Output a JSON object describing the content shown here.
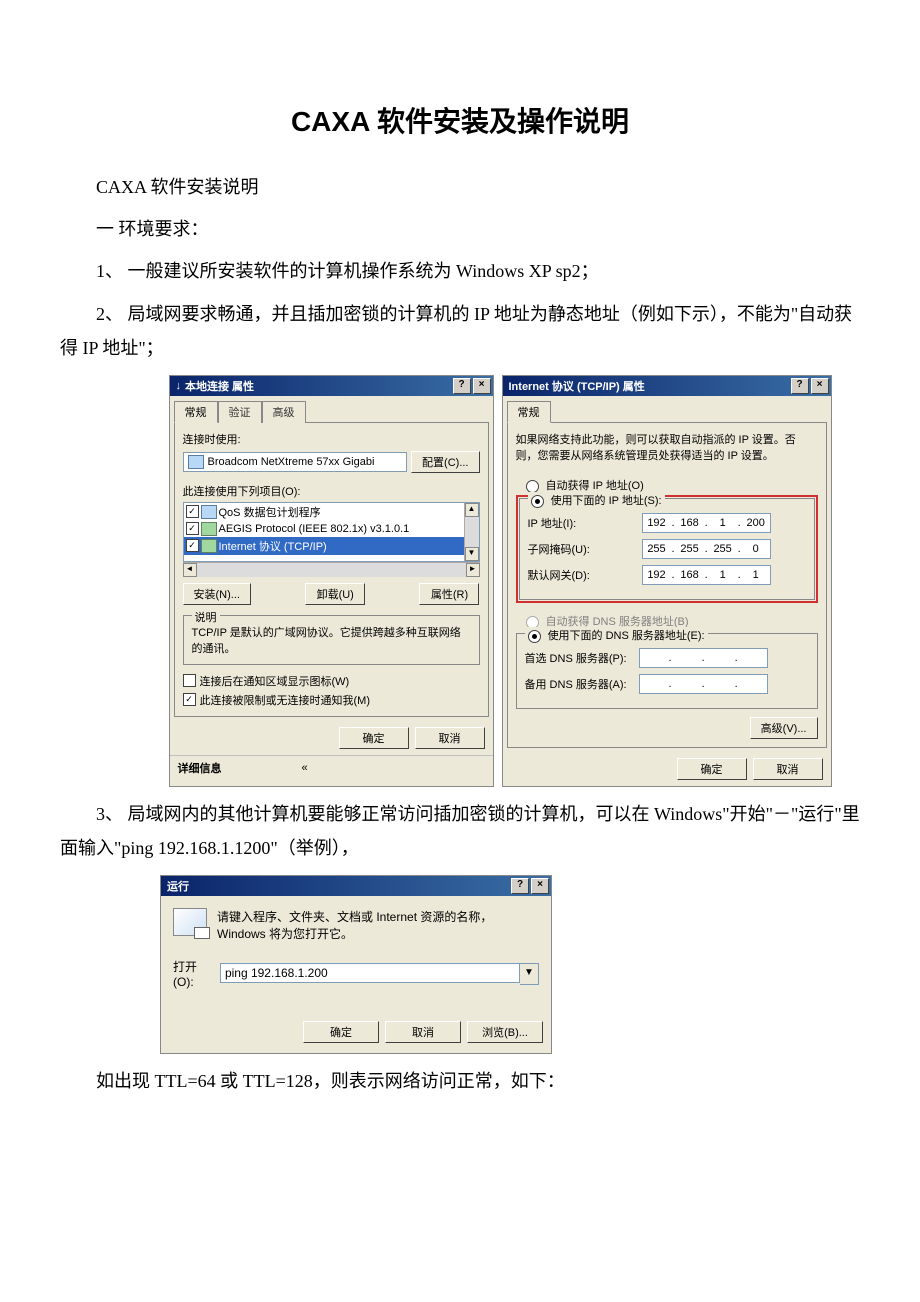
{
  "title": "CAXA 软件安装及操作说明",
  "p_sub": "CAXA 软件安装说明",
  "p_env": "一 环境要求：",
  "p1": "1、 一般建议所安装软件的计算机操作系统为 Windows XP sp2；",
  "p2": "2、 局域网要求畅通，并且插加密锁的计算机的 IP 地址为静态地址（例如下示），不能为\"自动获得 IP 地址\"；",
  "p3": "3、 局域网内的其他计算机要能够正常访问插加密锁的计算机，可以在 Windows\"开始\"－\"运行\"里面输入\"ping 192.168.1.1200\"（举例），",
  "p4": "如出现 TTL=64 或 TTL=128，则表示网络访问正常，如下：",
  "lan": {
    "title": "本地连接 属性",
    "tabs": {
      "general": "常规",
      "auth": "验证",
      "adv": "高级"
    },
    "connect_using": "连接时使用:",
    "adapter": "Broadcom NetXtreme 57xx Gigabi",
    "configure": "配置(C)...",
    "items_label": "此连接使用下列项目(O):",
    "items": {
      "qos": "QoS 数据包计划程序",
      "aegis": "AEGIS Protocol (IEEE 802.1x) v3.1.0.1",
      "tcpip": "Internet 协议 (TCP/IP)"
    },
    "install": "安装(N)...",
    "uninstall": "卸载(U)",
    "props": "属性(R)",
    "desc_title": "说明",
    "desc": "TCP/IP 是默认的广域网协议。它提供跨越多种互联网络的通讯。",
    "cb1": "连接后在通知区域显示图标(W)",
    "cb2": "此连接被限制或无连接时通知我(M)",
    "ok": "确定",
    "cancel": "取消",
    "details": "详细信息",
    "chev": "«"
  },
  "ip": {
    "title": "Internet 协议 (TCP/IP) 属性",
    "tab": "常规",
    "intro": "如果网络支持此功能，则可以获取自动指派的 IP 设置。否则，您需要从网络系统管理员处获得适当的 IP 设置。",
    "auto_ip": "自动获得 IP 地址(O)",
    "use_ip": "使用下面的 IP 地址(S):",
    "ip_label": "IP 地址(I):",
    "mask_label": "子网掩码(U):",
    "gw_label": "默认网关(D):",
    "ip_val": [
      "192",
      "168",
      "1",
      "200"
    ],
    "mask_val": [
      "255",
      "255",
      "255",
      "0"
    ],
    "gw_val": [
      "192",
      "168",
      "1",
      "1"
    ],
    "auto_dns": "自动获得 DNS 服务器地址(B)",
    "use_dns": "使用下面的 DNS 服务器地址(E):",
    "dns1": "首选 DNS 服务器(P):",
    "dns2": "备用 DNS 服务器(A):",
    "adv": "高级(V)...",
    "ok": "确定",
    "cancel": "取消"
  },
  "run": {
    "title": "运行",
    "hint": "请键入程序、文件夹、文档或 Internet 资源的名称，Windows 将为您打开它。",
    "open": "打开(O):",
    "value": "ping 192.168.1.200",
    "ok": "确定",
    "cancel": "取消",
    "browse": "浏览(B)..."
  }
}
